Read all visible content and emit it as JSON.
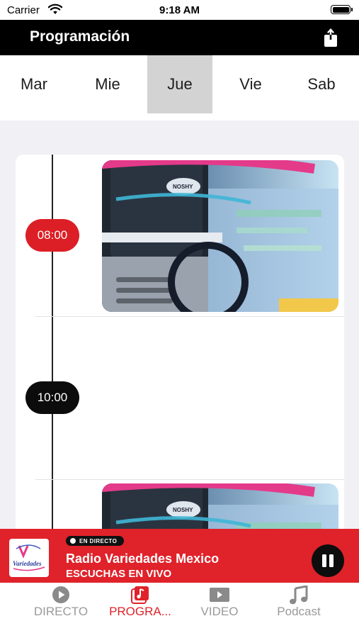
{
  "status_bar": {
    "carrier": "Carrier",
    "time": "9:18 AM"
  },
  "header": {
    "title": "Programación",
    "share_icon": "share-icon"
  },
  "days": [
    {
      "label": "Mar",
      "selected": false
    },
    {
      "label": "Mie",
      "selected": false
    },
    {
      "label": "Jue",
      "selected": true
    },
    {
      "label": "Vie",
      "selected": false
    },
    {
      "label": "Sab",
      "selected": false
    }
  ],
  "schedule": {
    "slots": [
      {
        "time": "08:00",
        "current": true,
        "has_image": true
      },
      {
        "time": "10:00",
        "current": false,
        "has_image": false
      },
      {
        "time": "",
        "current": false,
        "has_image": true
      }
    ]
  },
  "player": {
    "live_label": "EN DIRECTO",
    "station": "Radio Variedades Mexico",
    "subtitle": "ESCUCHAS EN VIVO",
    "logo_text": "Variedades",
    "state": "playing"
  },
  "tabs": [
    {
      "label": "DIRECTO",
      "icon": "play-circle-icon",
      "active": false
    },
    {
      "label": "PROGRA...",
      "icon": "music-note-square-icon",
      "active": true
    },
    {
      "label": "VIDEO",
      "icon": "video-play-icon",
      "active": false
    },
    {
      "label": "Podcast",
      "icon": "music-notes-icon",
      "active": false
    }
  ],
  "colors": {
    "accent": "#e0222a",
    "selected_day": "#d3d3d3",
    "nav": "#000000"
  }
}
